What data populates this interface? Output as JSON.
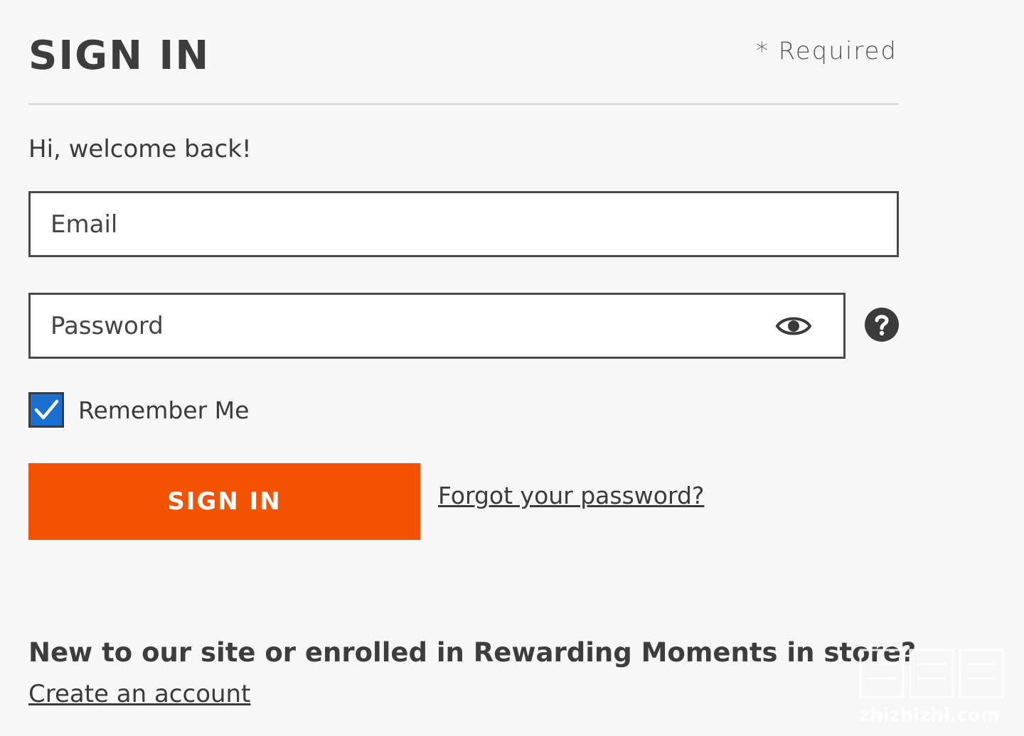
{
  "header": {
    "title": "SIGN IN",
    "required_note": "* Required"
  },
  "form": {
    "welcome": "Hi, welcome back!",
    "email": {
      "placeholder": "Email",
      "value": ""
    },
    "password": {
      "placeholder": "Password",
      "value": ""
    },
    "remember_me": {
      "label": "Remember Me",
      "checked": true
    },
    "submit_label": "SIGN IN",
    "forgot_password_label": "Forgot your password?"
  },
  "signup": {
    "heading": "New to our site or enrolled in Rewarding Moments in store?",
    "link_label": "Create an account"
  },
  "icons": {
    "password_toggle": "eye-icon",
    "help": "question-circle-icon",
    "checkbox": "checkmark-icon"
  },
  "colors": {
    "background": "#f7f7f7",
    "primary_button": "#f45200",
    "checkbox": "#1a6fd0",
    "text": "#3b3b3b"
  },
  "watermark": {
    "brand": "zhizhizhi.com"
  }
}
